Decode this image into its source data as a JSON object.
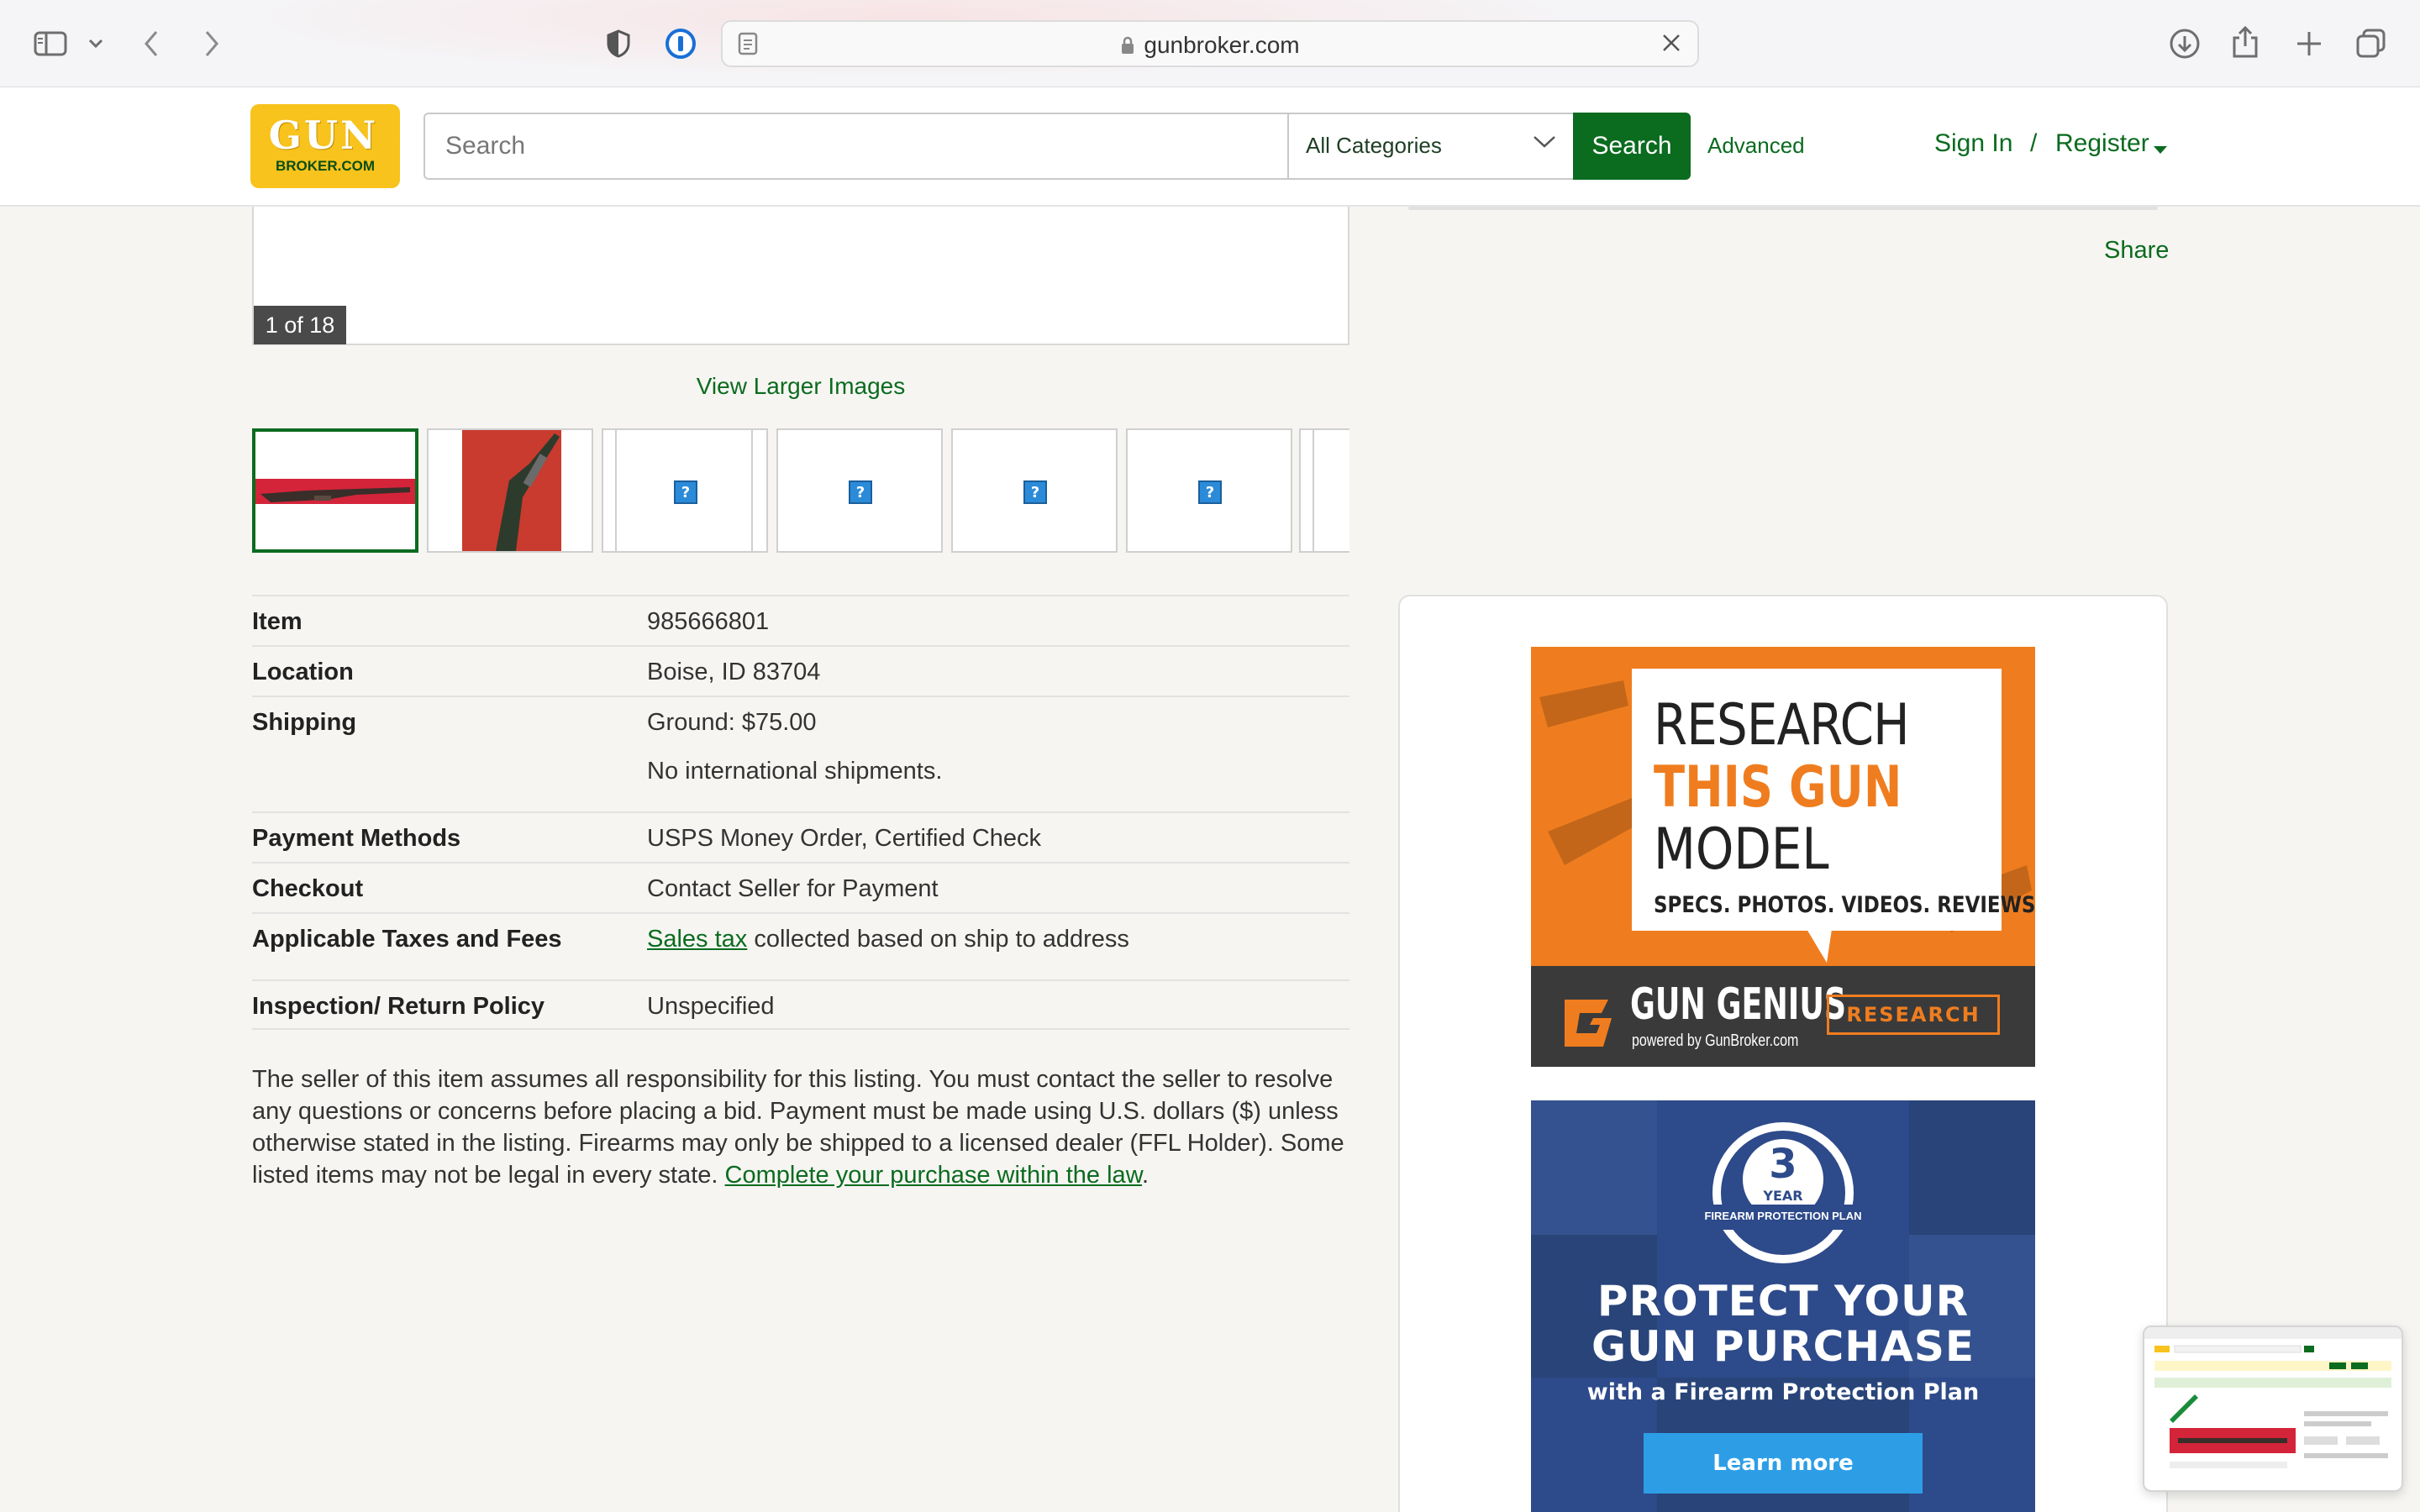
{
  "browser": {
    "url": "gunbroker.com",
    "icons": [
      "sidebar-icon",
      "chevron-down-icon",
      "back-icon",
      "forward-icon",
      "privacy-shield-icon",
      "password-manager-icon",
      "reader-icon",
      "lock-icon",
      "close-icon",
      "download-icon",
      "share-icon",
      "new-tab-icon",
      "tabs-overview-icon"
    ]
  },
  "header": {
    "logo": {
      "line1": "GUN",
      "line2": "BROKER.COM"
    },
    "search_placeholder": "Search",
    "category": "All Categories",
    "search_button": "Search",
    "advanced": "Advanced",
    "sign_in": "Sign In",
    "separator": "/",
    "register": "Register"
  },
  "gallery": {
    "counter": "1 of 18",
    "view_larger": "View Larger Images"
  },
  "details": {
    "item": {
      "label": "Item",
      "value": "985666801"
    },
    "location": {
      "label": "Location",
      "value": "Boise, ID 83704"
    },
    "shipping": {
      "label": "Shipping",
      "value": "Ground: $75.00",
      "note": "No international shipments."
    },
    "payment": {
      "label": "Payment Methods",
      "value": "USPS Money Order, Certified Check"
    },
    "checkout": {
      "label": "Checkout",
      "value": "Contact Seller for Payment"
    },
    "taxes": {
      "label": "Applicable Taxes and Fees",
      "link": "Sales tax",
      "value": " collected based on ship to address"
    },
    "inspection": {
      "label": "Inspection/ Return Policy",
      "value": "Unspecified"
    }
  },
  "disclaimer": {
    "text": "The seller of this item assumes all responsibility for this listing. You must contact the seller to resolve any questions or concerns before placing a bid. Payment must be made using U.S. dollars ($) unless otherwise stated in the listing. Firearms may only be shipped to a licensed dealer (FFL Holder). Some listed items may not be legal in every state. ",
    "link": "Complete your purchase within the law",
    "end": "."
  },
  "sidebar": {
    "share": "Share"
  },
  "ads": {
    "research": {
      "line1": "RESEARCH",
      "line2": "THIS GUN",
      "line3": "MODEL",
      "line4": "SPECS. PHOTOS. VIDEOS. REVIEWS.",
      "brand": "GUN GENIUS",
      "powered": "powered by GunBroker.com",
      "button": "RESEARCH"
    },
    "protection": {
      "badge_number": "3",
      "badge_unit": "YEAR",
      "badge_text": "FIREARM PROTECTION PLAN",
      "line1": "PROTECT YOUR",
      "line2": "GUN PURCHASE",
      "line3": "with a Firearm Protection Plan",
      "button": "Learn more"
    }
  },
  "colors": {
    "brand_green": "#0b6b1f",
    "logo_yellow": "#f7c31c",
    "ad_orange": "#ef7d1f",
    "ad_blue": "#2d4a8a"
  }
}
